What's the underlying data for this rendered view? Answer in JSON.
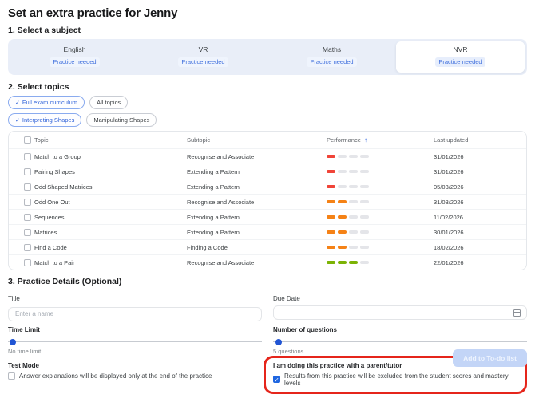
{
  "page_title": "Set an extra practice for Jenny",
  "colors": {
    "accent_blue": "#2e62d9",
    "annotation_red": "#e5251b",
    "strip_bg": "#e9eef8",
    "performance": {
      "low": "#f04438",
      "medium": "#f58216",
      "high": "#7cb305",
      "empty": "#e4e5e9"
    }
  },
  "subject": {
    "heading": "1. Select a subject",
    "badge_label": "Practice needed",
    "subjects": [
      {
        "name": "English",
        "selected": false
      },
      {
        "name": "VR",
        "selected": false
      },
      {
        "name": "Maths",
        "selected": false
      },
      {
        "name": "NVR",
        "selected": true
      }
    ]
  },
  "topics": {
    "heading": "2. Select topics",
    "curriculum_chips": [
      {
        "label": "Full exam curriculum",
        "selected": true
      },
      {
        "label": "All topics",
        "selected": false
      }
    ],
    "topic_chips": [
      {
        "label": "Interpreting Shapes",
        "selected": true
      },
      {
        "label": "Manipulating Shapes",
        "selected": false
      }
    ],
    "table": {
      "columns": {
        "topic": "Topic",
        "subtopic": "Subtopic",
        "performance": "Performance",
        "last_updated": "Last updated"
      },
      "sort": {
        "column": "Performance",
        "direction": "asc",
        "arrow": "↑"
      },
      "rows": [
        {
          "topic": "Match to a Group",
          "subtopic": "Recognise and Associate",
          "performance": {
            "filled": 1,
            "level": "low"
          },
          "last_updated": "31/01/2026"
        },
        {
          "topic": "Pairing Shapes",
          "subtopic": "Extending a Pattern",
          "performance": {
            "filled": 1,
            "level": "low"
          },
          "last_updated": "31/01/2026"
        },
        {
          "topic": "Odd Shaped Matrices",
          "subtopic": "Extending a Pattern",
          "performance": {
            "filled": 1,
            "level": "low"
          },
          "last_updated": "05/03/2026"
        },
        {
          "topic": "Odd One Out",
          "subtopic": "Recognise and Associate",
          "performance": {
            "filled": 2,
            "level": "medium"
          },
          "last_updated": "31/03/2026"
        },
        {
          "topic": "Sequences",
          "subtopic": "Extending a Pattern",
          "performance": {
            "filled": 2,
            "level": "medium"
          },
          "last_updated": "11/02/2026"
        },
        {
          "topic": "Matrices",
          "subtopic": "Extending a Pattern",
          "performance": {
            "filled": 2,
            "level": "medium"
          },
          "last_updated": "30/01/2026"
        },
        {
          "topic": "Find a Code",
          "subtopic": "Finding a Code",
          "performance": {
            "filled": 2,
            "level": "medium"
          },
          "last_updated": "18/02/2026"
        },
        {
          "topic": "Match to a Pair",
          "subtopic": "Recognise and Associate",
          "performance": {
            "filled": 3,
            "level": "high"
          },
          "last_updated": "22/01/2026"
        }
      ]
    }
  },
  "details": {
    "heading": "3. Practice Details (Optional)",
    "title_field": {
      "label": "Title",
      "placeholder": "Enter a name",
      "value": ""
    },
    "due_date": {
      "label": "Due Date",
      "value": ""
    },
    "time_limit": {
      "label": "Time Limit",
      "value_text": "No time limit"
    },
    "num_questions": {
      "label": "Number of questions",
      "value_text": "5 questions"
    },
    "test_mode": {
      "label": "Test Mode",
      "checkbox_label": "Answer explanations will be displayed only at the end of the practice",
      "checked": false
    },
    "parent_tutor": {
      "label": "I am doing this practice with a parent/tutor",
      "checkbox_label": "Results from this practice will be excluded from the student scores and mastery levels",
      "checked": true,
      "highlighted": true
    }
  },
  "footer": {
    "submit_label": "Add to To-do list",
    "enabled": false
  }
}
